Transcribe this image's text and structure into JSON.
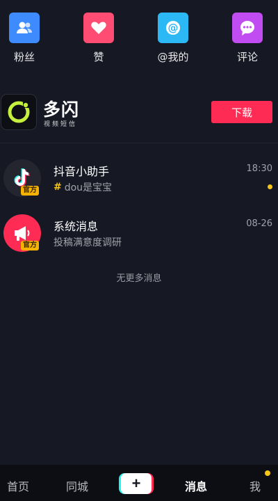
{
  "quick_actions": [
    {
      "label": "粉丝",
      "icon": "fans-icon",
      "color": "#3d8bfd"
    },
    {
      "label": "赞",
      "icon": "heart-icon",
      "color": "#fe4c72"
    },
    {
      "label": "@我的",
      "icon": "at-icon",
      "color": "#2bb8f5"
    },
    {
      "label": "评论",
      "icon": "comment-icon",
      "color": "#c04cf2"
    }
  ],
  "banner": {
    "app_name": "多闪",
    "app_subtitle": "视频短信",
    "download_label": "下载"
  },
  "messages": [
    {
      "title": "抖音小助手",
      "time": "18:30",
      "preview": "dou是宝宝",
      "badge": "官方",
      "unread": true
    },
    {
      "title": "系统消息",
      "time": "08-26",
      "preview": "投稿满意度调研",
      "badge": "官方",
      "unread": false
    }
  ],
  "no_more_text": "无更多消息",
  "tabbar": {
    "home": "首页",
    "nearby": "同城",
    "add": "+",
    "messages": "消息",
    "me": "我",
    "active": "消息"
  },
  "colors": {
    "background": "#161823",
    "accent": "#fe2c55",
    "unread_dot": "#f5c518"
  }
}
